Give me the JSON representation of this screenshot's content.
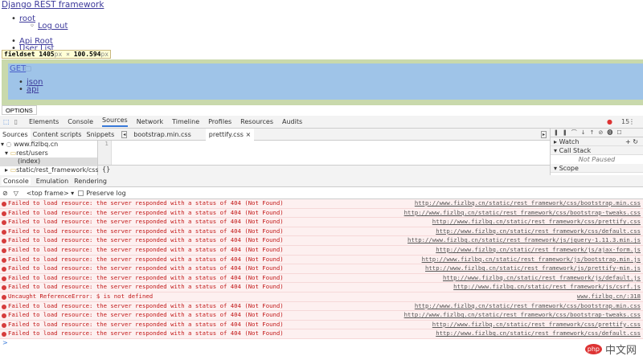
{
  "page": {
    "title": "Django REST framework",
    "nav_user": "root",
    "logout": "Log out",
    "breadcrumbs": [
      "Api Root",
      "User List"
    ],
    "tooltip": {
      "tag": "fieldset",
      "width": "1405",
      "height": "100.594",
      "unit": "px",
      "sep": "×"
    },
    "get_label": "GET",
    "formats": [
      "json",
      "api"
    ],
    "options_label": "OPTIONS"
  },
  "devtools": {
    "tabs": [
      "Elements",
      "Console",
      "Sources",
      "Network",
      "Timeline",
      "Profiles",
      "Resources",
      "Audits"
    ],
    "active_tab": "Sources",
    "error_count": "15",
    "nav_tabs": [
      "Sources",
      "Content scripts",
      "Snippets"
    ],
    "file_tabs": [
      "bootstrap.min.css",
      "prettify.css"
    ],
    "tree": [
      "www.fizlbq.cn",
      "rest/users",
      "(index)",
      "static/rest_framework/css"
    ],
    "line_number": "1",
    "pretty_print": "{}",
    "debugger": {
      "watch": "Watch",
      "call_stack": "Call Stack",
      "not_paused": "Not Paused",
      "scope": "Scope"
    },
    "drawer_tabs": [
      "Console",
      "Emulation",
      "Rendering"
    ],
    "frame": "<top frame>",
    "preserve_log": "Preserve log",
    "messages": [
      {
        "text": "Failed to load resource: the server responded with a status of 404 (Not Found)",
        "source": "http://www.fizlbq.cn/static/rest_framework/css/bootstrap.min.css"
      },
      {
        "text": "Failed to load resource: the server responded with a status of 404 (Not Found)",
        "source": "http://www.fizlbq.cn/static/rest_framework/css/bootstrap-tweaks.css"
      },
      {
        "text": "Failed to load resource: the server responded with a status of 404 (Not Found)",
        "source": "http://www.fizlbq.cn/static/rest_framework/css/prettify.css"
      },
      {
        "text": "Failed to load resource: the server responded with a status of 404 (Not Found)",
        "source": "http://www.fizlbq.cn/static/rest_framework/css/default.css"
      },
      {
        "text": "Failed to load resource: the server responded with a status of 404 (Not Found)",
        "source": "http://www.fizlbq.cn/static/rest_framework/js/jquery-1.11.3.min.js"
      },
      {
        "text": "Failed to load resource: the server responded with a status of 404 (Not Found)",
        "source": "http://www.fizlbq.cn/static/rest_framework/js/ajax-form.js"
      },
      {
        "text": "Failed to load resource: the server responded with a status of 404 (Not Found)",
        "source": "http://www.fizlbq.cn/static/rest_framework/js/bootstrap.min.js"
      },
      {
        "text": "Failed to load resource: the server responded with a status of 404 (Not Found)",
        "source": "http://www.fizlbq.cn/static/rest_framework/js/prettify-min.js"
      },
      {
        "text": "Failed to load resource: the server responded with a status of 404 (Not Found)",
        "source": "http://www.fizlbq.cn/static/rest_framework/js/default.js"
      },
      {
        "text": "Failed to load resource: the server responded with a status of 404 (Not Found)",
        "source": "http://www.fizlbq.cn/static/rest_framework/js/csrf.js"
      },
      {
        "text": "Uncaught ReferenceError: $ is not defined",
        "source": "www.fizlbq.cn/:318"
      },
      {
        "text": "Failed to load resource: the server responded with a status of 404 (Not Found)",
        "source": "http://www.fizlbq.cn/static/rest_framework/css/bootstrap.min.css"
      },
      {
        "text": "Failed to load resource: the server responded with a status of 404 (Not Found)",
        "source": "http://www.fizlbq.cn/static/rest_framework/css/bootstrap-tweaks.css"
      },
      {
        "text": "Failed to load resource: the server responded with a status of 404 (Not Found)",
        "source": "http://www.fizlbq.cn/static/rest_framework/css/prettify.css"
      },
      {
        "text": "Failed to load resource: the server responded with a status of 404 (Not Found)",
        "source": "http://www.fizlbq.cn/static/rest_framework/css/default.css"
      }
    ],
    "prompt": ">"
  },
  "watermark": {
    "logo": "php",
    "text": "中文网"
  }
}
